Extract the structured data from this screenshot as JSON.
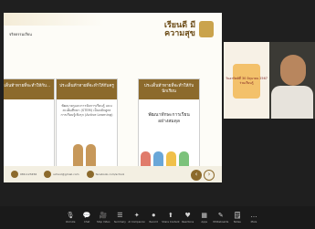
{
  "slide": {
    "title": "จริยธรรมเรียน",
    "logo_text": "เรียนดี มีความสุข",
    "cards": [
      {
        "heading": "ประเด็นท้าทายที่จะทำให้กับ...",
        "body": ""
      },
      {
        "heading": "ประเด็นท้าทายที่จะทำให้กับครู",
        "body": "พัฒนาครูและการจัดการเรียนรู้ แบบสะเต็มศึกษา (STEM) เป็นหลักสูตรการเรียนรู้เชิงรุก (Active Learning)"
      },
      {
        "heading": "ประเด็นท้าทายที่จะทำให้กับนักเรียน",
        "body": "พัฒนาทักษะการเรียน อย่างสมดุล"
      }
    ],
    "footer": {
      "phone": "080-123456",
      "email": "school@gmail.com",
      "facebook": "facebook.com/school"
    },
    "nav": {
      "prev": "‹",
      "next": "›"
    }
  },
  "gallery": {
    "badge_text": "วันอาทิตย์ที่ 30 มิถุนายน 2567 ร่วมเรียนรู้"
  },
  "toolbar": [
    {
      "icon": "microphone-icon",
      "glyph": "🎙",
      "label": "Unmute"
    },
    {
      "icon": "chat-icon",
      "glyph": "💬",
      "label": "Chat"
    },
    {
      "icon": "camera-icon",
      "glyph": "🎥",
      "label": "Stop Video"
    },
    {
      "icon": "summary-icon",
      "glyph": "☰",
      "label": "Summary"
    },
    {
      "icon": "companion-icon",
      "glyph": "✦",
      "label": "AI Companion"
    },
    {
      "icon": "record-icon",
      "glyph": "⏺",
      "label": "Record"
    },
    {
      "icon": "share-icon",
      "glyph": "⬆",
      "label": "Share Content"
    },
    {
      "icon": "reactions-icon",
      "glyph": "♥",
      "label": "Reactions"
    },
    {
      "icon": "apps-icon",
      "glyph": "▦",
      "label": "Apps"
    },
    {
      "icon": "whiteboard-icon",
      "glyph": "✎",
      "label": "Whiteboards"
    },
    {
      "icon": "notes-icon",
      "glyph": "🗒",
      "label": "Notes"
    },
    {
      "icon": "more-icon",
      "glyph": "…",
      "label": "More"
    }
  ],
  "colors": {
    "accent": "#8c6a2c",
    "camera_on": "#21c37a"
  }
}
